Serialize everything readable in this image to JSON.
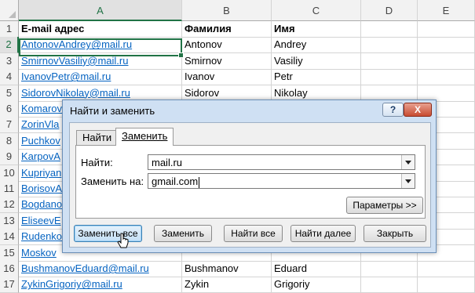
{
  "sheet": {
    "columns": [
      "A",
      "B",
      "C",
      "D",
      "E"
    ],
    "rows": [
      {
        "num": "1",
        "email": "E-mail адрес",
        "last": "Фамилия",
        "first": "Имя"
      },
      {
        "num": "2",
        "email": "AntonovAndrey@mail.ru",
        "last": "Antonov",
        "first": "Andrey"
      },
      {
        "num": "3",
        "email": "SmirnovVasiliy@mail.ru",
        "last": "Smirnov",
        "first": "Vasiliy"
      },
      {
        "num": "4",
        "email": "IvanovPetr@mail.ru",
        "last": "Ivanov",
        "first": "Petr"
      },
      {
        "num": "5",
        "email": "SidorovNikolay@mail.ru",
        "last": "Sidorov",
        "first": "Nikolay"
      },
      {
        "num": "6",
        "email": "Komarov",
        "last": "",
        "first": ""
      },
      {
        "num": "7",
        "email": "ZorinVla",
        "last": "",
        "first": ""
      },
      {
        "num": "8",
        "email": "Puchkov",
        "last": "",
        "first": ""
      },
      {
        "num": "9",
        "email": "KarpovA",
        "last": "",
        "first": ""
      },
      {
        "num": "10",
        "email": "Kupriyan",
        "last": "",
        "first": ""
      },
      {
        "num": "11",
        "email": "BorisovA",
        "last": "",
        "first": ""
      },
      {
        "num": "12",
        "email": "Bogdano",
        "last": "",
        "first": ""
      },
      {
        "num": "13",
        "email": "EliseevE",
        "last": "",
        "first": ""
      },
      {
        "num": "14",
        "email": "Rudenko",
        "last": "",
        "first": ""
      },
      {
        "num": "15",
        "email": "Moskov",
        "last": "",
        "first": ""
      },
      {
        "num": "16",
        "email": "BushmanovEduard@mail.ru",
        "last": "Bushmanov",
        "first": "Eduard"
      },
      {
        "num": "17",
        "email": "ZykinGrigoriy@mail.ru",
        "last": "Zykin",
        "first": "Grigoriy"
      }
    ]
  },
  "dialog": {
    "title": "Найти и заменить",
    "help_label": "?",
    "close_label": "X",
    "tabs": {
      "find": "Найти",
      "replace": "Заменить"
    },
    "find_label": "Найти:",
    "find_value": "mail.ru",
    "replace_label": "Заменить на:",
    "replace_value": "gmail.com",
    "options_button": "Параметры >>",
    "buttons": {
      "replace_all": "Заменить все",
      "replace": "Заменить",
      "find_all": "Найти все",
      "find_next": "Найти далее",
      "close": "Закрыть"
    }
  },
  "colors": {
    "accent": "#217346",
    "link": "#0563c1",
    "dialog_frame": "#cfe0f3"
  }
}
